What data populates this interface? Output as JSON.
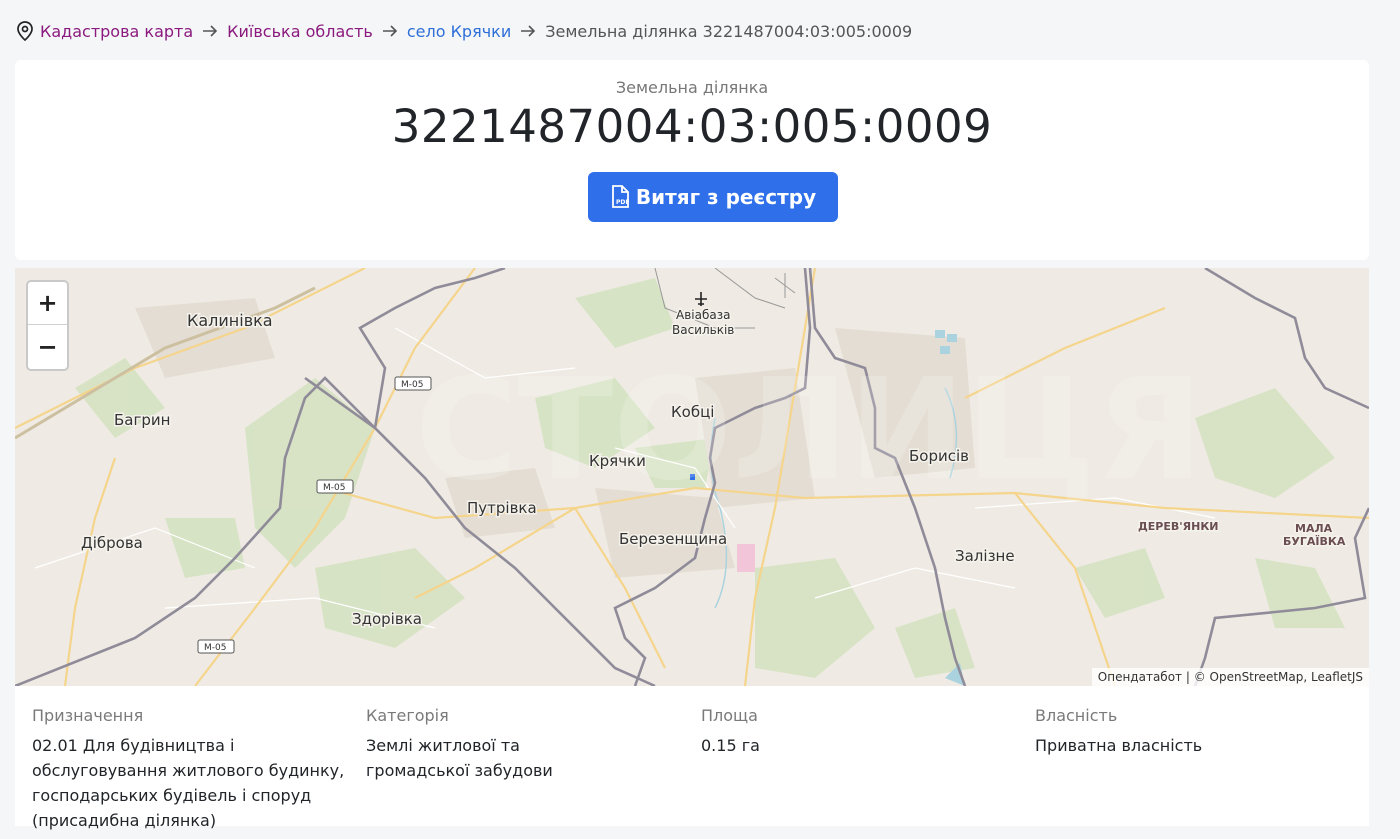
{
  "breadcrumb": {
    "root": "Кадастрова карта",
    "region": "Київська область",
    "village": "село Крячки",
    "current": "Земельна ділянка 3221487004:03:005:0009"
  },
  "header": {
    "label": "Земельна ділянка",
    "cadastral_number": "3221487004:03:005:0009",
    "button_label": "Витяг з реєстру"
  },
  "map": {
    "zoom_in": "+",
    "zoom_out": "−",
    "attribution": "Опендатабот | © OpenStreetMap, LeafletJS",
    "places": [
      "Калинівка",
      "Авіабаза",
      "Васильків",
      "Кобці",
      "Багрин",
      "Крячки",
      "Борисів",
      "Путрівка",
      "Березенщина",
      "Діброва",
      "Залізне",
      "Здорівка",
      "ДЕРЕВ'ЯНКИ",
      "МАЛА",
      "БУГАЇВКА"
    ],
    "road_labels": [
      "M-05",
      "M-05",
      "M-05"
    ]
  },
  "details": {
    "purpose_label": "Призначення",
    "purpose_value": "02.01 Для будівництва і обслуговування житлового будинку, господарських будівель і споруд (присадибна ділянка)",
    "category_label": "Категорія",
    "category_value": "Землі житлової та громадської забудови",
    "area_label": "Площа",
    "area_value": "0.15 га",
    "ownership_label": "Власність",
    "ownership_value": "Приватна власність"
  }
}
